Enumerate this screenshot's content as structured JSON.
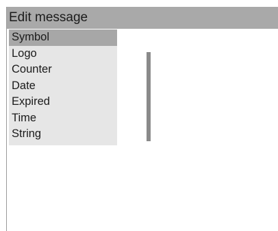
{
  "window": {
    "title": "Edit message"
  },
  "list": {
    "items": [
      {
        "label": "Symbol",
        "selected": true
      },
      {
        "label": "Logo",
        "selected": false
      },
      {
        "label": "Counter",
        "selected": false
      },
      {
        "label": "Date",
        "selected": false
      },
      {
        "label": "Expired",
        "selected": false
      },
      {
        "label": "Time",
        "selected": false
      },
      {
        "label": "String",
        "selected": false
      }
    ]
  },
  "icons": {
    "scroll_down": "triangle-down-icon"
  },
  "colors": {
    "title_bar": "#a9a9a9",
    "list_background": "#e6e6e6",
    "selected_item": "#a7a7a7",
    "divider": "#8a8a8a"
  }
}
